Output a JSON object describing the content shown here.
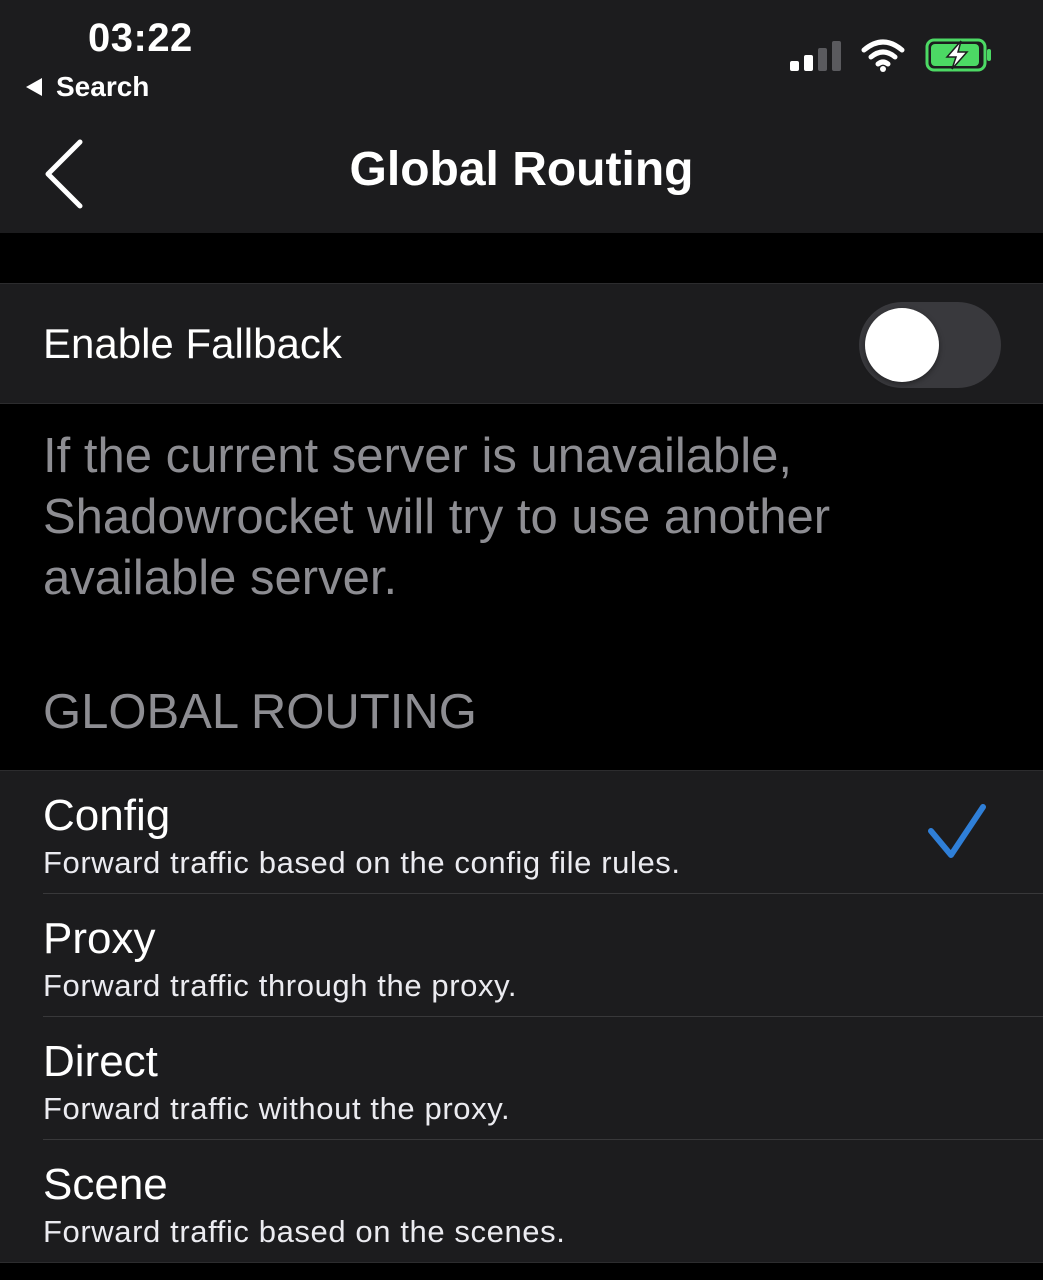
{
  "status_bar": {
    "time": "03:22",
    "back_app": "Search",
    "icons": [
      "signal-icon",
      "wifi-icon",
      "battery-charging-icon"
    ]
  },
  "nav": {
    "title": "Global Routing",
    "back_icon": "chevron-left-icon"
  },
  "fallback": {
    "label": "Enable Fallback",
    "enabled": false,
    "footer": "If the current server is unavailable, Shadowrocket will try to use another available server."
  },
  "routing": {
    "header": "GLOBAL ROUTING",
    "selected": "Config",
    "options": [
      {
        "title": "Config",
        "description": "Forward traffic based on the config file rules."
      },
      {
        "title": "Proxy",
        "description": "Forward traffic through the proxy."
      },
      {
        "title": "Direct",
        "description": "Forward traffic without the proxy."
      },
      {
        "title": "Scene",
        "description": "Forward traffic based on the scenes."
      }
    ]
  },
  "colors": {
    "background": "#000000",
    "surface": "#1c1c1e",
    "secondary_text": "#8d8d92",
    "checkmark": "#2f7fd8",
    "battery": "#4cd964",
    "toggle_off": "#39393d"
  }
}
